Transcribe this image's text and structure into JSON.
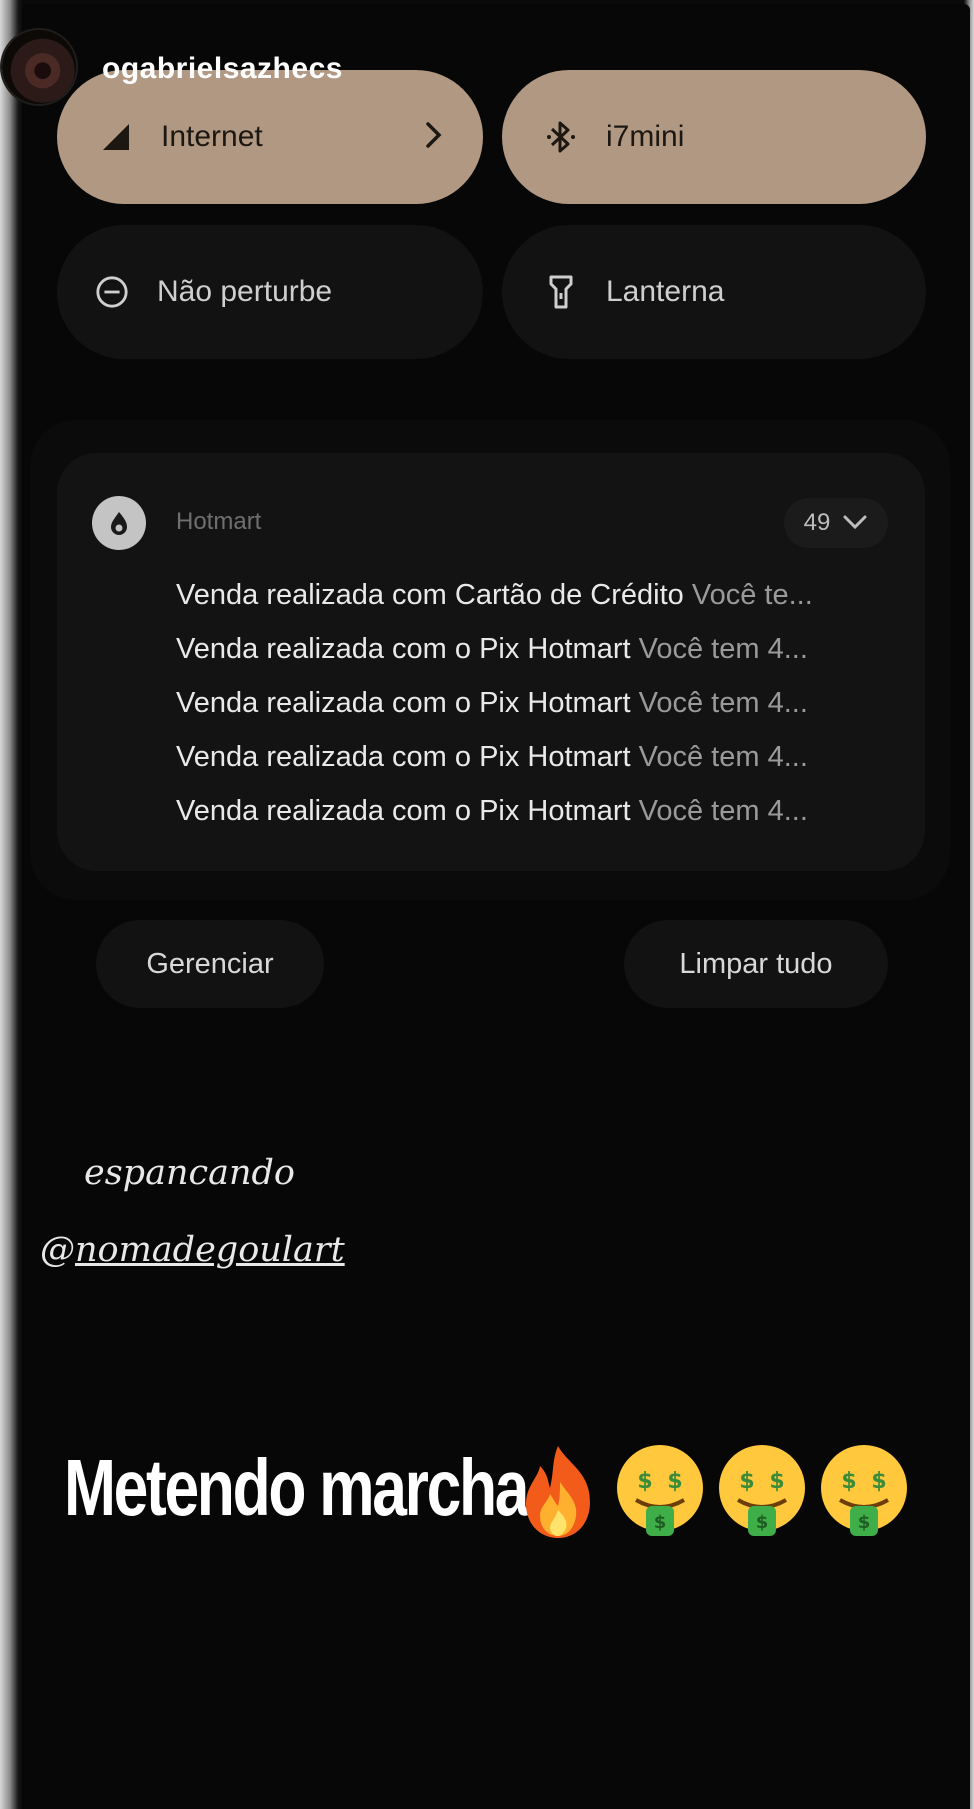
{
  "story": {
    "username": "ogabrielsazhecs"
  },
  "quick_settings": {
    "tiles": [
      {
        "label": "Internet",
        "icon": "signal-icon",
        "state": "active"
      },
      {
        "label": "i7mini",
        "icon": "bluetooth-icon",
        "state": "active"
      },
      {
        "label": "Não perturbe",
        "icon": "do-not-disturb-icon",
        "state": "inactive"
      },
      {
        "label": "Lanterna",
        "icon": "flashlight-icon",
        "state": "inactive"
      }
    ]
  },
  "notification": {
    "app_name": "Hotmart",
    "count": "49",
    "items": [
      {
        "title": "Venda realizada com Cartão de Crédito",
        "body": "Você te..."
      },
      {
        "title": "Venda realizada com o Pix Hotmart",
        "body": "Você tem 4..."
      },
      {
        "title": "Venda realizada com o Pix Hotmart",
        "body": "Você tem 4..."
      },
      {
        "title": "Venda realizada com o Pix Hotmart",
        "body": "Você tem 4..."
      },
      {
        "title": "Venda realizada com o Pix Hotmart",
        "body": "Você tem 4..."
      }
    ]
  },
  "actions": {
    "manage_label": "Gerenciar",
    "clear_label": "Limpar tudo"
  },
  "overlays": {
    "caption_line1": "espancando",
    "caption_line2_prefix": "@",
    "caption_line2_handle": "nomadegoulart",
    "headline": "Metendo marcha",
    "emojis": [
      "fire-emoji",
      "money-mouth-face-emoji",
      "money-mouth-face-emoji",
      "money-mouth-face-emoji"
    ]
  },
  "colors": {
    "active_tile": "#b09883",
    "inactive_tile": "#121212",
    "background": "#070707"
  }
}
